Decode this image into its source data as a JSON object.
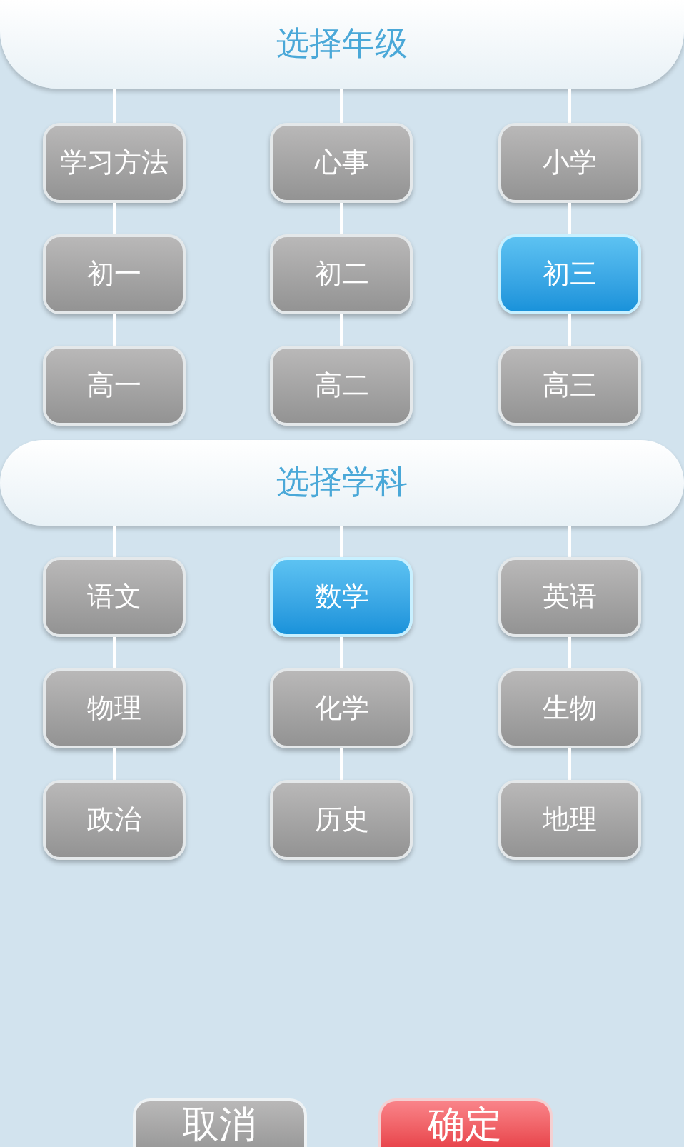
{
  "grade_section": {
    "title": "选择年级",
    "options": [
      {
        "label": "学习方法",
        "selected": false
      },
      {
        "label": "心事",
        "selected": false
      },
      {
        "label": "小学",
        "selected": false
      },
      {
        "label": "初一",
        "selected": false
      },
      {
        "label": "初二",
        "selected": false
      },
      {
        "label": "初三",
        "selected": true
      },
      {
        "label": "高一",
        "selected": false
      },
      {
        "label": "高二",
        "selected": false
      },
      {
        "label": "高三",
        "selected": false
      }
    ]
  },
  "subject_section": {
    "title": "选择学科",
    "options": [
      {
        "label": "语文",
        "selected": false
      },
      {
        "label": "数学",
        "selected": true
      },
      {
        "label": "英语",
        "selected": false
      },
      {
        "label": "物理",
        "selected": false
      },
      {
        "label": "化学",
        "selected": false
      },
      {
        "label": "生物",
        "selected": false
      },
      {
        "label": "政治",
        "selected": false
      },
      {
        "label": "历史",
        "selected": false
      },
      {
        "label": "地理",
        "selected": false
      }
    ]
  },
  "buttons": [
    {
      "label": "取消",
      "kind": "cancel"
    },
    {
      "label": "确定",
      "kind": "confirm"
    }
  ]
}
